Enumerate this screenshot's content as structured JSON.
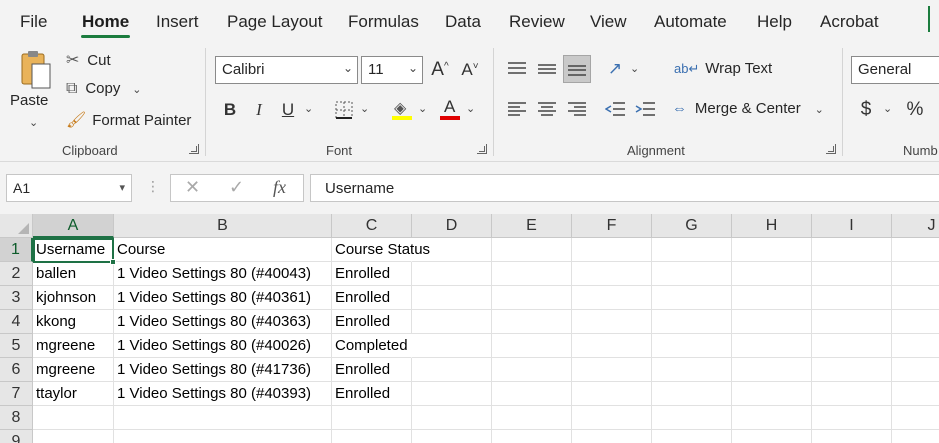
{
  "menu": {
    "tabs": [
      "File",
      "Home",
      "Insert",
      "Page Layout",
      "Formulas",
      "Data",
      "Review",
      "View",
      "Automate",
      "Help",
      "Acrobat"
    ]
  },
  "ribbon": {
    "clipboard": {
      "paste": "Paste",
      "cut": "Cut",
      "copy": "Copy",
      "format_painter": "Format Painter",
      "label": "Clipboard"
    },
    "font": {
      "name": "Calibri",
      "size": "11",
      "label": "Font",
      "bold": "B",
      "italic": "I",
      "underline": "U",
      "grow": "A^",
      "shrink": "A˅",
      "font_color_glyph": "A"
    },
    "alignment": {
      "wrap_text": "Wrap Text",
      "merge_center": "Merge & Center",
      "label": "Alignment"
    },
    "number": {
      "format": "General",
      "currency": "$",
      "percent": "%",
      "label": "Numb"
    }
  },
  "formula_bar": {
    "name_box": "A1",
    "fx": "fx",
    "content": "Username"
  },
  "sheet": {
    "columns": [
      "A",
      "B",
      "C",
      "D",
      "E",
      "F",
      "G",
      "H",
      "I",
      "J"
    ],
    "row_numbers": [
      "1",
      "2",
      "3",
      "4",
      "5",
      "6",
      "7",
      "8",
      "9"
    ],
    "header": [
      "Username",
      "Course",
      "Course Status"
    ],
    "rows": [
      [
        "ballen",
        "1 Video Settings 80 (#40043)",
        "Enrolled"
      ],
      [
        "kjohnson",
        "1 Video Settings 80 (#40361)",
        "Enrolled"
      ],
      [
        "kkong",
        "1 Video Settings 80 (#40363)",
        "Enrolled"
      ],
      [
        "mgreene",
        "1 Video Settings 80 (#40026)",
        "Completed"
      ],
      [
        "mgreene",
        "1 Video Settings 80 (#41736)",
        "Enrolled"
      ],
      [
        "ttaylor",
        "1 Video Settings 80 (#40393)",
        "Enrolled"
      ]
    ]
  },
  "colors": {
    "accent": "#1e7145",
    "tab_underline": "#1b7c3e",
    "highlight_yellow": "#ffff00",
    "font_red": "#e00000"
  }
}
